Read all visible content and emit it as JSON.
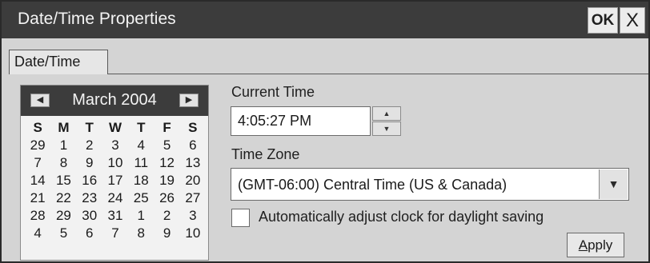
{
  "window": {
    "title": "Date/Time Properties",
    "ok_label": "OK",
    "close_label": "X"
  },
  "tabs": [
    {
      "label": "Date/Time",
      "active": true
    }
  ],
  "calendar": {
    "month_label": "March 2004",
    "prev_icon": "left-arrow-icon",
    "next_icon": "right-arrow-icon",
    "weekdays": [
      "S",
      "M",
      "T",
      "W",
      "T",
      "F",
      "S"
    ],
    "weeks": [
      [
        "29",
        "1",
        "2",
        "3",
        "4",
        "5",
        "6"
      ],
      [
        "7",
        "8",
        "9",
        "10",
        "11",
        "12",
        "13"
      ],
      [
        "14",
        "15",
        "16",
        "17",
        "18",
        "19",
        "20"
      ],
      [
        "21",
        "22",
        "23",
        "24",
        "25",
        "26",
        "27"
      ],
      [
        "28",
        "29",
        "30",
        "31",
        "1",
        "2",
        "3"
      ],
      [
        "4",
        "5",
        "6",
        "7",
        "8",
        "9",
        "10"
      ]
    ]
  },
  "current_time": {
    "label": "Current Time",
    "value": "4:05:27 PM"
  },
  "time_zone": {
    "label": "Time Zone",
    "selected": "(GMT-06:00) Central Time (US & Canada)"
  },
  "daylight": {
    "label": "Automatically adjust clock for daylight saving",
    "checked": false
  },
  "apply": {
    "mnemonic": "A",
    "rest": "pply"
  },
  "colors": {
    "titlebar": "#3c3c3c",
    "window_bg": "#d4d4d4",
    "field_bg": "#ffffff"
  }
}
